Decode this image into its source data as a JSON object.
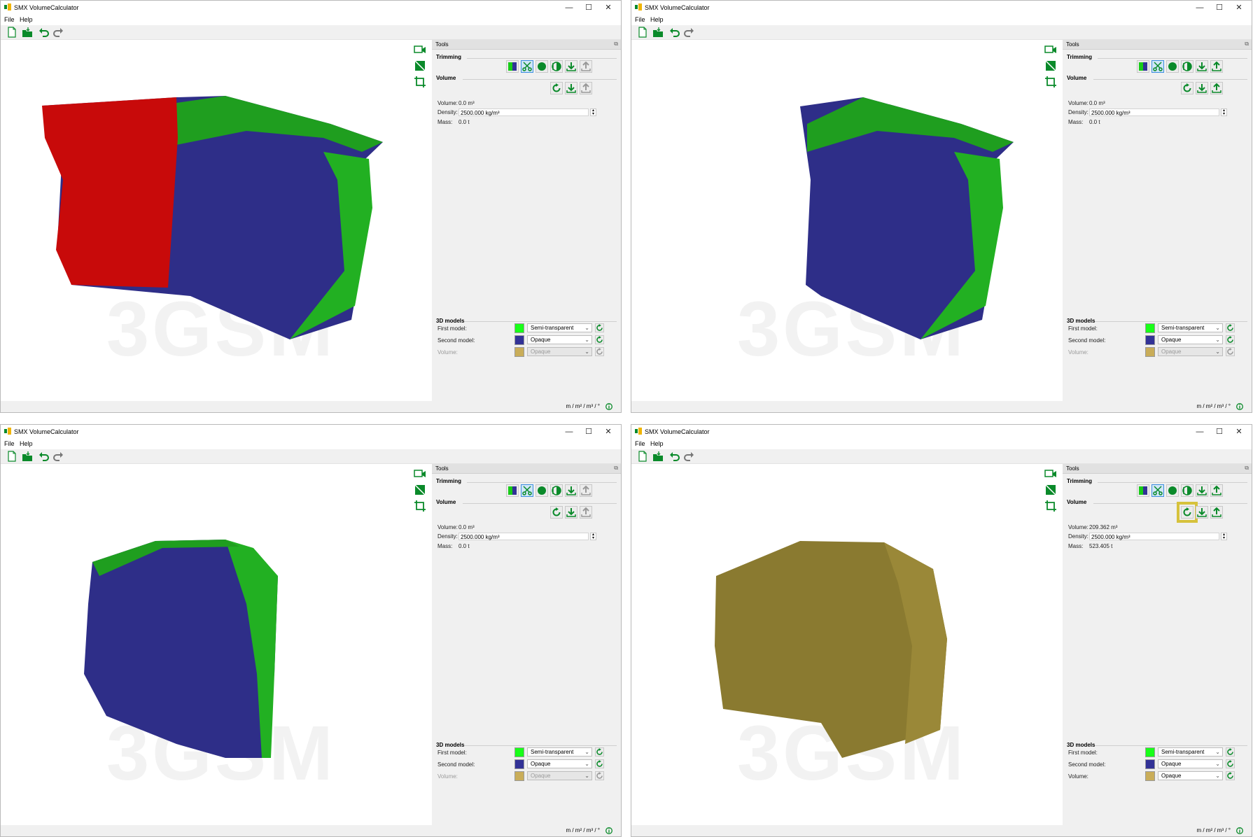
{
  "app": {
    "title": "SMX VolumeCalculator"
  },
  "window_controls": {
    "minimize": "—",
    "maximize": "☐",
    "close": "✕"
  },
  "menu": {
    "file": "File",
    "help": "Help"
  },
  "toolbar_icons": [
    "new-file-icon",
    "open-folder-icon",
    "undo-icon",
    "redo-icon"
  ],
  "view_icons": [
    "camera-view-icon",
    "section-view-icon",
    "crop-view-icon"
  ],
  "panel": {
    "title": "Tools",
    "trimming_label": "Trimming",
    "volume_label": "Volume",
    "models_label": "3D models",
    "volume_row_label": "Volume:",
    "density_row_label": "Density:",
    "mass_row_label": "Mass:",
    "first_model_label": "First model:",
    "second_model_label": "Second model:",
    "volume_model_label": "Volume:"
  },
  "units": "m / m² / m³ / °",
  "watermark": "3GSM",
  "colors": {
    "accent_green": "#0a8a2a",
    "first_model": "#18ff18",
    "second_model": "#323296",
    "volume_model": "#c9ad59",
    "highlight": "#d6c23c"
  },
  "screens": [
    {
      "step": 1,
      "volume": "0.0 m³",
      "density": "2500.000 kg/m³",
      "mass": "0.0 t",
      "first_model": "Semi-transparent",
      "second_model": "Opaque",
      "volume_model": "Opaque",
      "volume_enabled": false
    },
    {
      "step": 2,
      "volume": "0.0 m³",
      "density": "2500.000 kg/m³",
      "mass": "0.0 t",
      "first_model": "Semi-transparent",
      "second_model": "Opaque",
      "volume_model": "Opaque",
      "volume_enabled": false
    },
    {
      "step": 3,
      "volume": "0.0 m³",
      "density": "2500.000 kg/m³",
      "mass": "0.0 t",
      "first_model": "Semi-transparent",
      "second_model": "Opaque",
      "volume_model": "Opaque",
      "volume_enabled": false
    },
    {
      "step": 4,
      "volume": "209.362 m³",
      "density": "2500.000 kg/m³",
      "mass": "523.405 t",
      "first_model": "Semi-transparent",
      "second_model": "Opaque",
      "volume_model": "Opaque",
      "volume_enabled": true
    }
  ]
}
